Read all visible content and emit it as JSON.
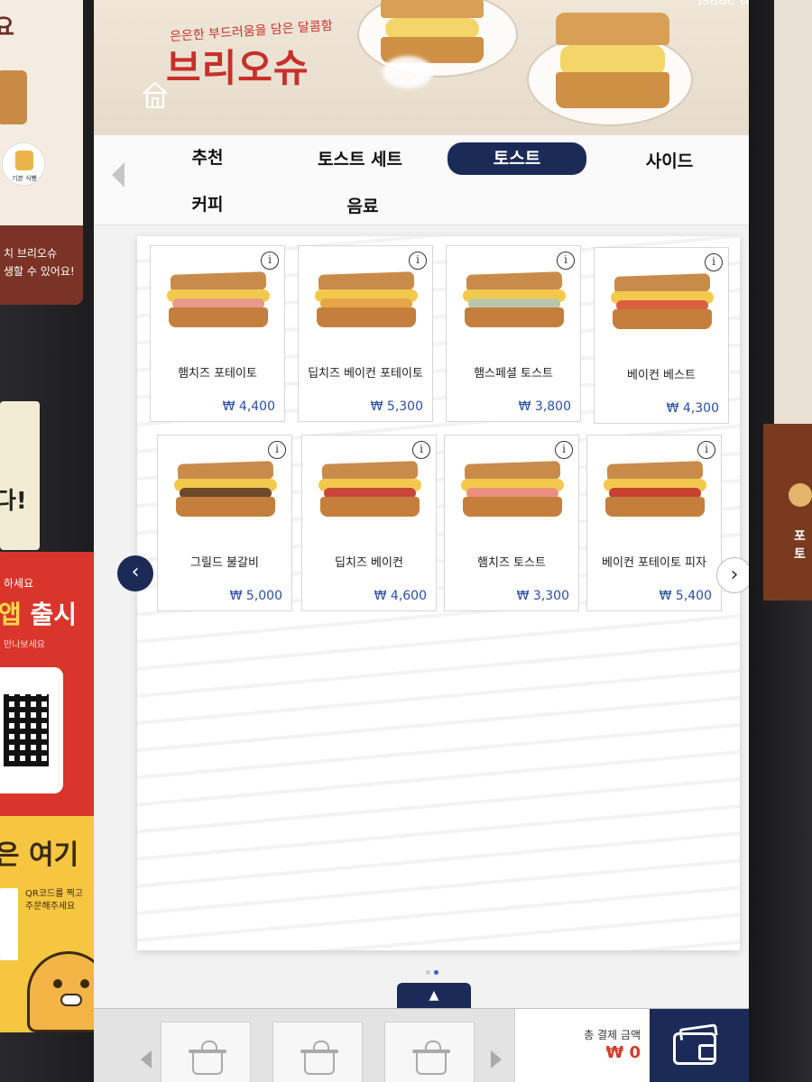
{
  "environment": {
    "promo_card": {
      "title": "요",
      "badge": "기본 식빵",
      "line1": "치 브리오슈",
      "line2": "생할 수 있어요!"
    },
    "sticker_dark": {
      "text": "다!"
    },
    "app_sticker": {
      "small": "하세요",
      "big_left": "앱",
      "big_right": " 출시",
      "sub": "만나보세요"
    },
    "yellow_sticker": {
      "big": "은 여기",
      "small_1": "QR코드를 찍고",
      "small_2": "주문해주세요"
    },
    "right_panel": {
      "text": "포토"
    }
  },
  "banner": {
    "subtitle": "은은한 부드러움을 담은 달콤함",
    "title": "브리오슈",
    "brand": "isaac toast"
  },
  "tabs": [
    {
      "label": "추천",
      "active": false
    },
    {
      "label": "토스트 세트",
      "active": false
    },
    {
      "label": "토스트",
      "active": true
    },
    {
      "label": "사이드",
      "active": false
    },
    {
      "label": "커피",
      "active": false
    },
    {
      "label": "음료",
      "active": false
    }
  ],
  "menu": {
    "items": [
      {
        "name": "햄치즈 포테이토",
        "price": "₩ 4,400",
        "info": "i",
        "filling": "#e79a8b"
      },
      {
        "name": "딥치즈 베이컨 포테이토",
        "price": "₩ 5,300",
        "info": "i",
        "filling": "#e5a64a"
      },
      {
        "name": "햄스페셜 토스트",
        "price": "₩ 3,800",
        "info": "i",
        "filling": "#b9c7a8"
      },
      {
        "name": "베이컨 베스트",
        "price": "₩ 4,300",
        "info": "i",
        "filling": "#d9603f"
      },
      {
        "name": "그릴드 불갈비",
        "price": "₩ 5,000",
        "info": "i",
        "filling": "#6e4a2c"
      },
      {
        "name": "딥치즈 베이컨",
        "price": "₩ 4,600",
        "info": "i",
        "filling": "#c9463a"
      },
      {
        "name": "햄치즈 토스트",
        "price": "₩ 3,300",
        "info": "i",
        "filling": "#e98f7c"
      },
      {
        "name": "베이컨 포테이토 피자",
        "price": "₩ 5,400",
        "info": "i",
        "filling": "#c8412f"
      }
    ],
    "prev_arrow": "‹",
    "next_arrow": "›",
    "page_current": 2,
    "page_total": 2
  },
  "bottom": {
    "up_arrow": "▲",
    "total_label": "총 결제 금액",
    "total_value": "₩ 0"
  },
  "colors": {
    "accent_navy": "#1b2a57",
    "price_blue": "#2b4fa3",
    "brand_red": "#c7302a"
  },
  "icons": {
    "home": "home-icon",
    "info": "info-icon",
    "basket": "basket-icon",
    "wallet": "wallet-icon"
  }
}
